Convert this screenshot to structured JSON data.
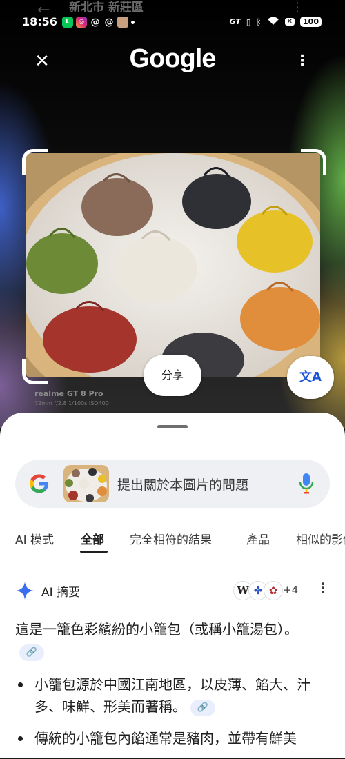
{
  "status_bar": {
    "time": "18:56",
    "carrier_label": "GT",
    "battery": "100",
    "ghost_title": "新北市 新莊區"
  },
  "header": {
    "logo": "Google"
  },
  "photo": {
    "watermark_brand": "realme GT 8 Pro",
    "watermark_detail": "72mm f/2.8 1/100s ISO400"
  },
  "actions": {
    "share_label": "分享",
    "translate_label": "文A"
  },
  "search": {
    "placeholder": "提出關於本圖片的問題"
  },
  "tabs": [
    {
      "label": "AI 模式"
    },
    {
      "label": "全部",
      "active": true
    },
    {
      "label": "完全相符的結果"
    },
    {
      "label": "產品"
    },
    {
      "label": "相似的影像"
    }
  ],
  "ai_overview": {
    "title": "AI 摘要",
    "source_count": "+4",
    "source_icons": [
      "wikipedia-icon",
      "paw-icon",
      "flower-icon"
    ],
    "paragraph": "這是一籠色彩繽紛的小籠包（或稱小籠湯包）。",
    "bullets": [
      "小籠包源於中國江南地區，以皮薄、餡大、汁多、味鮮、形美而著稱。",
      "傳統的小籠包內餡通常是豬肉，並帶有鮮美"
    ]
  },
  "colors": {
    "accent_blue": "#1a56d6",
    "sheet_bg": "#ffffff",
    "search_bg": "#eef0f3"
  }
}
